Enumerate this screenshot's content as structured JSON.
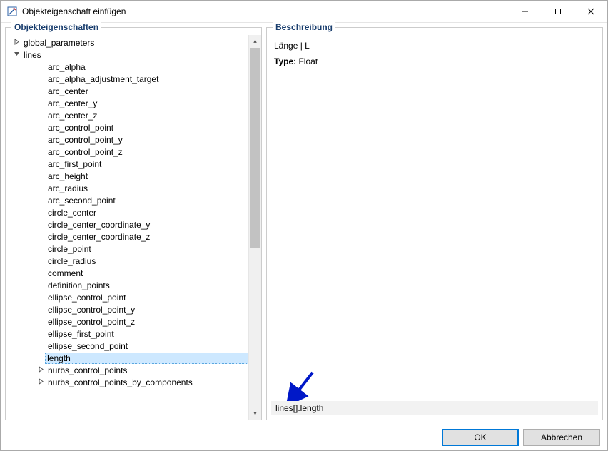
{
  "window": {
    "title": "Objekteigenschaft einfügen"
  },
  "left": {
    "title": "Objekteigenschaften",
    "tree": [
      {
        "level": 0,
        "expander": "right",
        "label": "global_parameters",
        "selected": false
      },
      {
        "level": 0,
        "expander": "down",
        "label": "lines",
        "selected": false
      },
      {
        "level": 1,
        "expander": "",
        "label": "arc_alpha",
        "selected": false
      },
      {
        "level": 1,
        "expander": "",
        "label": "arc_alpha_adjustment_target",
        "selected": false
      },
      {
        "level": 1,
        "expander": "",
        "label": "arc_center",
        "selected": false
      },
      {
        "level": 1,
        "expander": "",
        "label": "arc_center_y",
        "selected": false
      },
      {
        "level": 1,
        "expander": "",
        "label": "arc_center_z",
        "selected": false
      },
      {
        "level": 1,
        "expander": "",
        "label": "arc_control_point",
        "selected": false
      },
      {
        "level": 1,
        "expander": "",
        "label": "arc_control_point_y",
        "selected": false
      },
      {
        "level": 1,
        "expander": "",
        "label": "arc_control_point_z",
        "selected": false
      },
      {
        "level": 1,
        "expander": "",
        "label": "arc_first_point",
        "selected": false
      },
      {
        "level": 1,
        "expander": "",
        "label": "arc_height",
        "selected": false
      },
      {
        "level": 1,
        "expander": "",
        "label": "arc_radius",
        "selected": false
      },
      {
        "level": 1,
        "expander": "",
        "label": "arc_second_point",
        "selected": false
      },
      {
        "level": 1,
        "expander": "",
        "label": "circle_center",
        "selected": false
      },
      {
        "level": 1,
        "expander": "",
        "label": "circle_center_coordinate_y",
        "selected": false
      },
      {
        "level": 1,
        "expander": "",
        "label": "circle_center_coordinate_z",
        "selected": false
      },
      {
        "level": 1,
        "expander": "",
        "label": "circle_point",
        "selected": false
      },
      {
        "level": 1,
        "expander": "",
        "label": "circle_radius",
        "selected": false
      },
      {
        "level": 1,
        "expander": "",
        "label": "comment",
        "selected": false
      },
      {
        "level": 1,
        "expander": "",
        "label": "definition_points",
        "selected": false
      },
      {
        "level": 1,
        "expander": "",
        "label": "ellipse_control_point",
        "selected": false
      },
      {
        "level": 1,
        "expander": "",
        "label": "ellipse_control_point_y",
        "selected": false
      },
      {
        "level": 1,
        "expander": "",
        "label": "ellipse_control_point_z",
        "selected": false
      },
      {
        "level": 1,
        "expander": "",
        "label": "ellipse_first_point",
        "selected": false
      },
      {
        "level": 1,
        "expander": "",
        "label": "ellipse_second_point",
        "selected": false
      },
      {
        "level": 1,
        "expander": "",
        "label": "length",
        "selected": true
      },
      {
        "level": 1,
        "expander": "right",
        "label": "nurbs_control_points",
        "selected": false
      },
      {
        "level": 1,
        "expander": "right",
        "label": "nurbs_control_points_by_components",
        "selected": false
      }
    ]
  },
  "right": {
    "title": "Beschreibung",
    "desc_line": "Länge | L",
    "type_label": "Type:",
    "type_value": "Float",
    "path": "lines[].length"
  },
  "footer": {
    "ok": "OK",
    "cancel": "Abbrechen"
  }
}
